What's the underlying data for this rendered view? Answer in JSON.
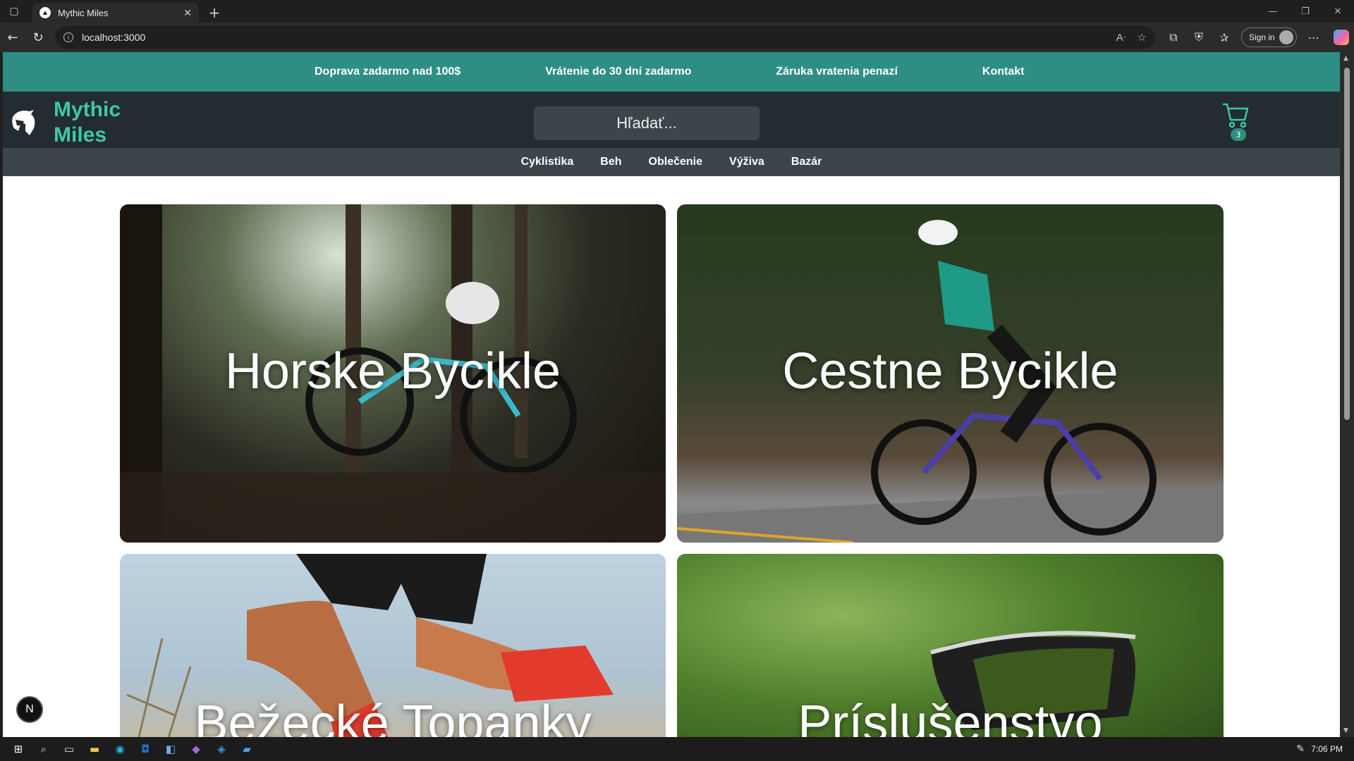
{
  "browser": {
    "tab_title": "Mythic Miles",
    "url": "localhost:3000",
    "signin_label": "Sign in"
  },
  "promo": {
    "items": [
      "Doprava zadarmo nad 100$",
      "Vrátenie do 30 dní zadarmo",
      "Záruka vratenia penazí",
      "Kontakt"
    ]
  },
  "header": {
    "brand": "Mythic Miles",
    "search_placeholder": "Hľadať...",
    "cart_count": "3"
  },
  "categories": [
    "Cyklistika",
    "Beh",
    "Oblečenie",
    "Výživa",
    "Bazár"
  ],
  "tiles": [
    "Horske Bycikle",
    "Cestne Bycikle",
    "Bežecké Topanky",
    "Príslušenstvo"
  ],
  "dev": {
    "next_badge": "N"
  },
  "taskbar": {
    "clock": "7:06 PM"
  },
  "colors": {
    "promo": "#2e8e84",
    "header": "#232c30",
    "brand": "#3ec7a6",
    "catnav": "#3c4549"
  }
}
